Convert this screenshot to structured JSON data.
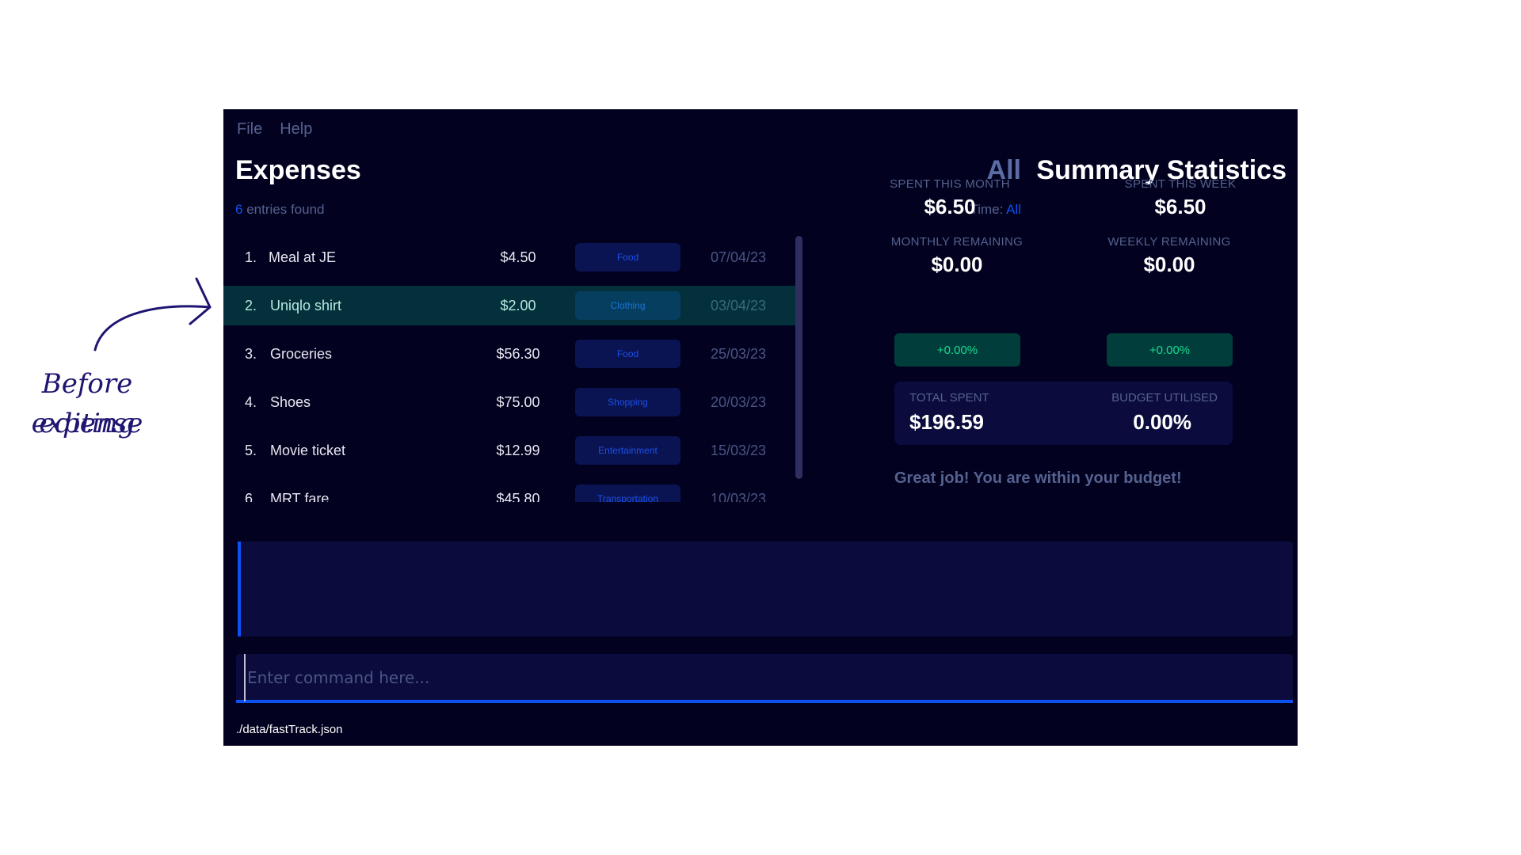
{
  "annotation": {
    "line1": "Before editing",
    "line2": "expense",
    "color": "#1e1570"
  },
  "menu": [
    "File",
    "Help"
  ],
  "expenses": {
    "title": "Expenses",
    "filter_label": "All",
    "entries_count": "6",
    "entries_suffix": " entries found",
    "time_label": "Time: ",
    "time_value": "All",
    "items": [
      {
        "index": "1.",
        "description": "Meal at JE",
        "amount": "$4.50",
        "category": "Food",
        "date": "07/04/23",
        "selected": false
      },
      {
        "index": "2.",
        "description": "Uniqlo shirt",
        "amount": "$2.00",
        "category": "Clothing",
        "date": "03/04/23",
        "selected": true
      },
      {
        "index": "3.",
        "description": "Groceries",
        "amount": "$56.30",
        "category": "Food",
        "date": "25/03/23",
        "selected": false
      },
      {
        "index": "4.",
        "description": "Shoes",
        "amount": "$75.00",
        "category": "Shopping",
        "date": "20/03/23",
        "selected": false
      },
      {
        "index": "5.",
        "description": "Movie ticket",
        "amount": "$12.99",
        "category": "Entertainment",
        "date": "15/03/23",
        "selected": false
      },
      {
        "index": "6.",
        "description": "MRT fare",
        "amount": "$45.80",
        "category": "Transportation",
        "date": "10/03/23",
        "selected": false
      }
    ]
  },
  "stats": {
    "title": "Summary Statistics",
    "spent_month_label": "SPENT THIS MONTH",
    "spent_month_value": "$6.50",
    "spent_week_label": "SPENT THIS WEEK",
    "spent_week_value": "$6.50",
    "monthly_remaining_label": "MONTHLY REMAINING",
    "monthly_remaining_value": "$0.00",
    "weekly_remaining_label": "WEEKLY REMAINING",
    "weekly_remaining_value": "$0.00",
    "monthly_change": "+0.00%",
    "weekly_change": "+0.00%",
    "total_spent_label": "TOTAL SPENT",
    "total_spent_value": "$196.59",
    "budget_utilised_label": "BUDGET UTILISED",
    "budget_utilised_value": "0.00%",
    "message": "Great job! You are within your budget!"
  },
  "result_text": "",
  "command": {
    "value": "",
    "placeholder": "Enter command here..."
  },
  "status_bar": {
    "file_path": "./data/fastTrack.json"
  },
  "colors": {
    "background": "#02011f",
    "accent": "#0d52f0",
    "selected_row": "#03303b",
    "positive": "#1ad98f"
  }
}
